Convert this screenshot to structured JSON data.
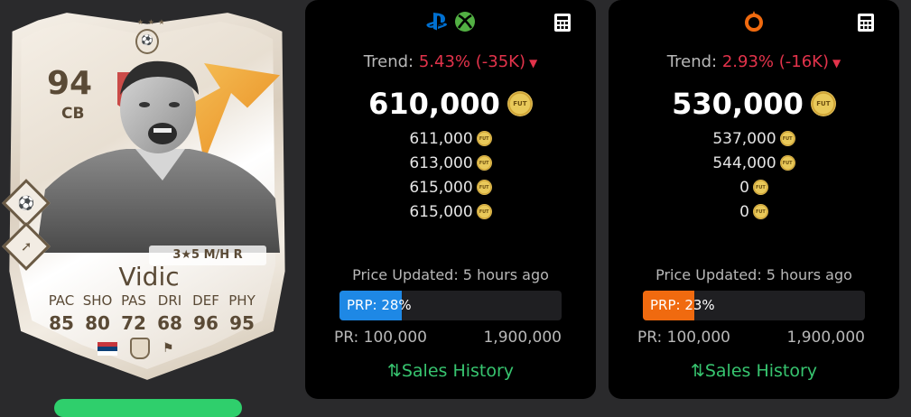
{
  "card": {
    "rating": "94",
    "position": "CB",
    "name": "Vidic",
    "skills_line": "3★5 M/H R",
    "stat_labels": [
      "PAC",
      "SHO",
      "PAS",
      "DRI",
      "DEF",
      "PHY"
    ],
    "stat_values": [
      "85",
      "80",
      "72",
      "68",
      "96",
      "95"
    ]
  },
  "panels": [
    {
      "platform": "playstation-xbox",
      "trend_label": "Trend:",
      "trend_value": "5.43% (-35K)",
      "main_price": "610,000",
      "prices": [
        "611,000",
        "613,000",
        "615,000",
        "615,000"
      ],
      "updated": "Price Updated: 5 hours ago",
      "prp_label": "PRP: 28%",
      "prp_percent": 28,
      "prp_color": "#1e88e5",
      "pr_min": "PR: 100,000",
      "pr_max": "1,900,000",
      "sales_label": "Sales History"
    },
    {
      "platform": "pc-origin",
      "trend_label": "Trend:",
      "trend_value": "2.93% (-16K)",
      "main_price": "530,000",
      "prices": [
        "537,000",
        "544,000",
        "0",
        "0"
      ],
      "updated": "Price Updated: 5 hours ago",
      "prp_label": "PRP: 23%",
      "prp_percent": 23,
      "prp_color": "#f06a0f",
      "pr_min": "PR: 100,000",
      "pr_max": "1,900,000",
      "sales_label": "Sales History"
    }
  ],
  "coin_text": "FUT",
  "colors": {
    "negative": "#e3334b",
    "sales": "#37c46f",
    "ps_blue": "#0070d1",
    "xbox_green": "#52b043",
    "origin_orange": "#f06a0f"
  }
}
